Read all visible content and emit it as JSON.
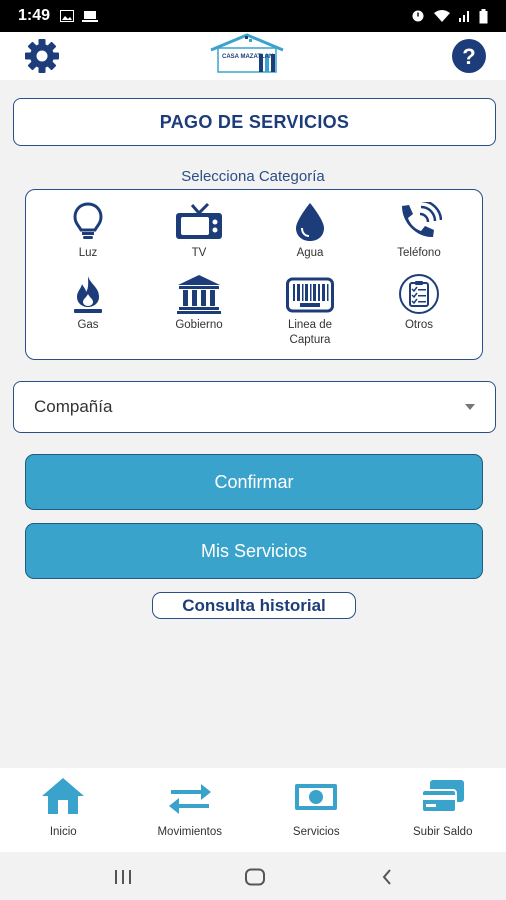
{
  "status_bar": {
    "time": "1:49"
  },
  "header": {
    "logo_text": "CASA MAZATLAN"
  },
  "page": {
    "title": "PAGO DE SERVICIOS",
    "category_label": "Selecciona Categoría"
  },
  "categories": [
    {
      "label": "Luz",
      "icon": "lightbulb-icon"
    },
    {
      "label": "TV",
      "icon": "tv-icon"
    },
    {
      "label": "Agua",
      "icon": "water-drop-icon"
    },
    {
      "label": "Teléfono",
      "icon": "phone-icon"
    },
    {
      "label": "Gas",
      "icon": "gas-flame-icon"
    },
    {
      "label": "Gobierno",
      "icon": "government-building-icon"
    },
    {
      "label": "Linea de Captura",
      "icon": "barcode-icon"
    },
    {
      "label": "Otros",
      "icon": "clipboard-icon"
    }
  ],
  "company_select": {
    "value": "Compañía"
  },
  "buttons": {
    "confirm": "Confirmar",
    "my_services": "Mis Servicios",
    "history": "Consulta historial"
  },
  "bottom_nav": [
    {
      "label": "Inicio",
      "icon": "home-icon"
    },
    {
      "label": "Movimientos",
      "icon": "transfer-arrows-icon"
    },
    {
      "label": "Servicios",
      "icon": "cash-icon"
    },
    {
      "label": "Subir Saldo",
      "icon": "cards-icon"
    }
  ],
  "colors": {
    "primary": "#1d3d7a",
    "button": "#3aa3cc",
    "accent": "#2a4f87"
  }
}
